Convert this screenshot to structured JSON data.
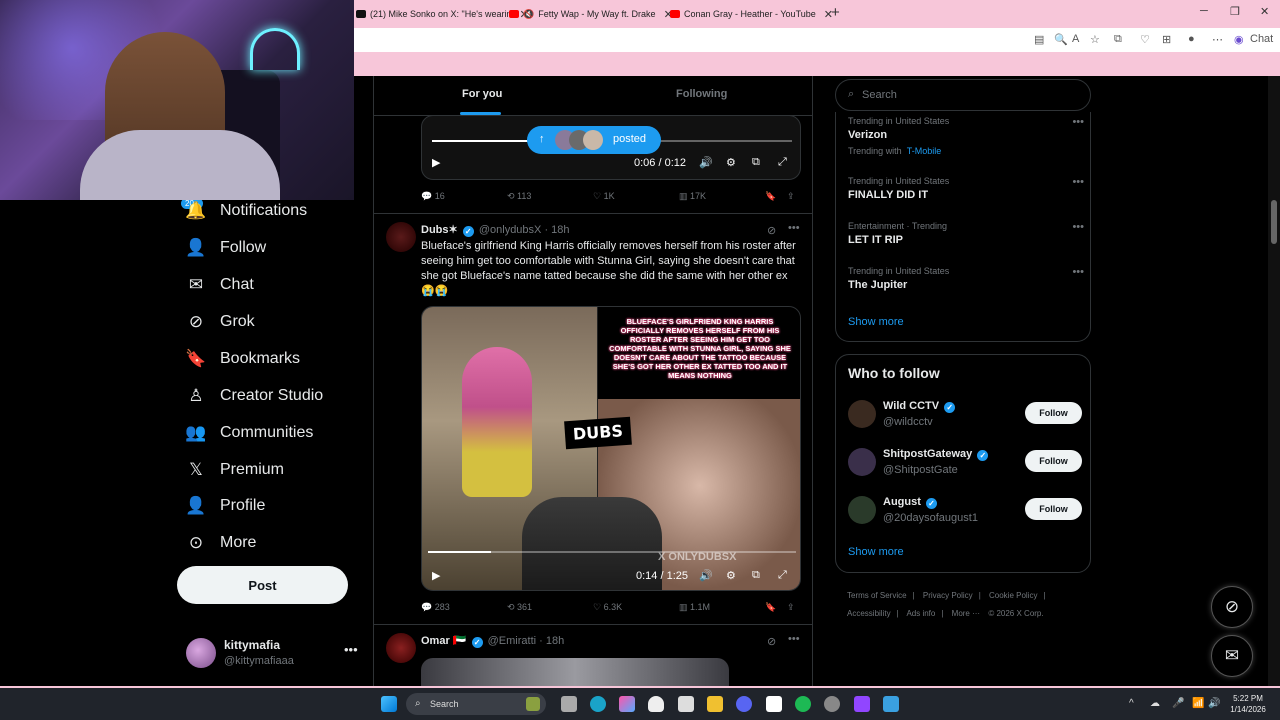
{
  "browser": {
    "tabs": [
      {
        "label": "(21) Mike Sonko on X: \"He's wearin",
        "color": "#111"
      },
      {
        "label": "Fetty Wap - My Way ft. Drake",
        "color": "#ff0000"
      },
      {
        "label": "Conan Gray - Heather - YouTube",
        "color": "#ff0000"
      }
    ],
    "chat_label": "Chat"
  },
  "nav": {
    "notif_badge": "20+",
    "items": [
      {
        "label": "Notifications",
        "icon": "bell-icon",
        "glyph": "🔔"
      },
      {
        "label": "Follow",
        "icon": "follow-person-icon",
        "glyph": "👤"
      },
      {
        "label": "Chat",
        "icon": "envelope-icon",
        "glyph": "✉"
      },
      {
        "label": "Grok",
        "icon": "grok-icon",
        "glyph": "⊘"
      },
      {
        "label": "Bookmarks",
        "icon": "bookmark-icon",
        "glyph": "🔖"
      },
      {
        "label": "Creator Studio",
        "icon": "creator-studio-icon",
        "glyph": "♙"
      },
      {
        "label": "Communities",
        "icon": "communities-icon",
        "glyph": "👥"
      },
      {
        "label": "Premium",
        "icon": "x-logo-icon",
        "glyph": "𝕏"
      },
      {
        "label": "Profile",
        "icon": "profile-icon",
        "glyph": "👤"
      },
      {
        "label": "More",
        "icon": "more-circle-icon",
        "glyph": "⊙"
      }
    ],
    "post_label": "Post",
    "account": {
      "name": "kittymafia",
      "handle": "@kittymafiaaa"
    }
  },
  "feed": {
    "tabs": {
      "for_you": "For you",
      "following": "Following"
    },
    "posted_pill": "posted",
    "post1": {
      "time": "0:06 / 0:12",
      "progress": 0.5,
      "replies": "16",
      "reposts": "113",
      "likes": "1K",
      "views": "17K"
    },
    "post2": {
      "name": "Dubs",
      "emoji": "✶",
      "handle": "@onlydubsX",
      "age": "· 18h",
      "text": "Blueface's girlfriend King Harris officially removes herself from his roster after seeing him get too comfortable with Stunna Girl, saying she doesn't care that she got Blueface's name tatted because she did the same with her other ex 😭😭",
      "video_caption": "BLUEFACE'S GIRLFRIEND KING HARRIS OFFICIALLY REMOVES HERSELF FROM HIS ROSTER AFTER SEEING HIM GET TOO COMFORTABLE WITH STUNNA GIRL, SAYING SHE DOESN'T CARE ABOUT THE TATTOO BECAUSE SHE'S GOT HER OTHER EX TATTED TOO AND IT MEANS NOTHING",
      "watermark_logo": "DUBS",
      "watermark_handle": "X ONLYDUBSX",
      "time": "0:14 / 1:25",
      "progress": 0.17,
      "replies": "283",
      "reposts": "361",
      "likes": "6.3K",
      "views": "1.1M"
    },
    "post3": {
      "name": "Omar",
      "flag": "🇦🇪",
      "handle": "@Emiratti",
      "age": "· 18h"
    }
  },
  "search": {
    "placeholder": "Search"
  },
  "trends": [
    {
      "meta": "Trending in United States",
      "title": "Verizon",
      "with_label": "Trending with",
      "with_link": "T-Mobile"
    },
    {
      "meta": "Trending in United States",
      "title": "FINALLY DID IT"
    },
    {
      "meta": "Entertainment · Trending",
      "title": "LET IT RIP"
    },
    {
      "meta": "Trending in United States",
      "title": "The Jupiter"
    }
  ],
  "show_more": "Show more",
  "who_to_follow": {
    "title": "Who to follow",
    "follow_label": "Follow",
    "users": [
      {
        "name": "Wild CCTV",
        "handle": "@wildcctv",
        "color": "#3a2a20"
      },
      {
        "name": "ShitpostGateway",
        "handle": "@ShitpostGate",
        "color": "#3a2f4a"
      },
      {
        "name": "August",
        "handle": "@20daysofaugust1",
        "color": "#2a3a2a"
      }
    ]
  },
  "footer": {
    "links": [
      "Terms of Service",
      "|",
      "Privacy Policy",
      "|",
      "Cookie Policy",
      "|",
      "Accessibility",
      "|",
      "Ads info",
      "|",
      "More ···",
      "© 2026 X Corp."
    ]
  },
  "taskbar": {
    "search_label": "Search",
    "time": "5:22 PM",
    "date": "1/14/2026"
  }
}
